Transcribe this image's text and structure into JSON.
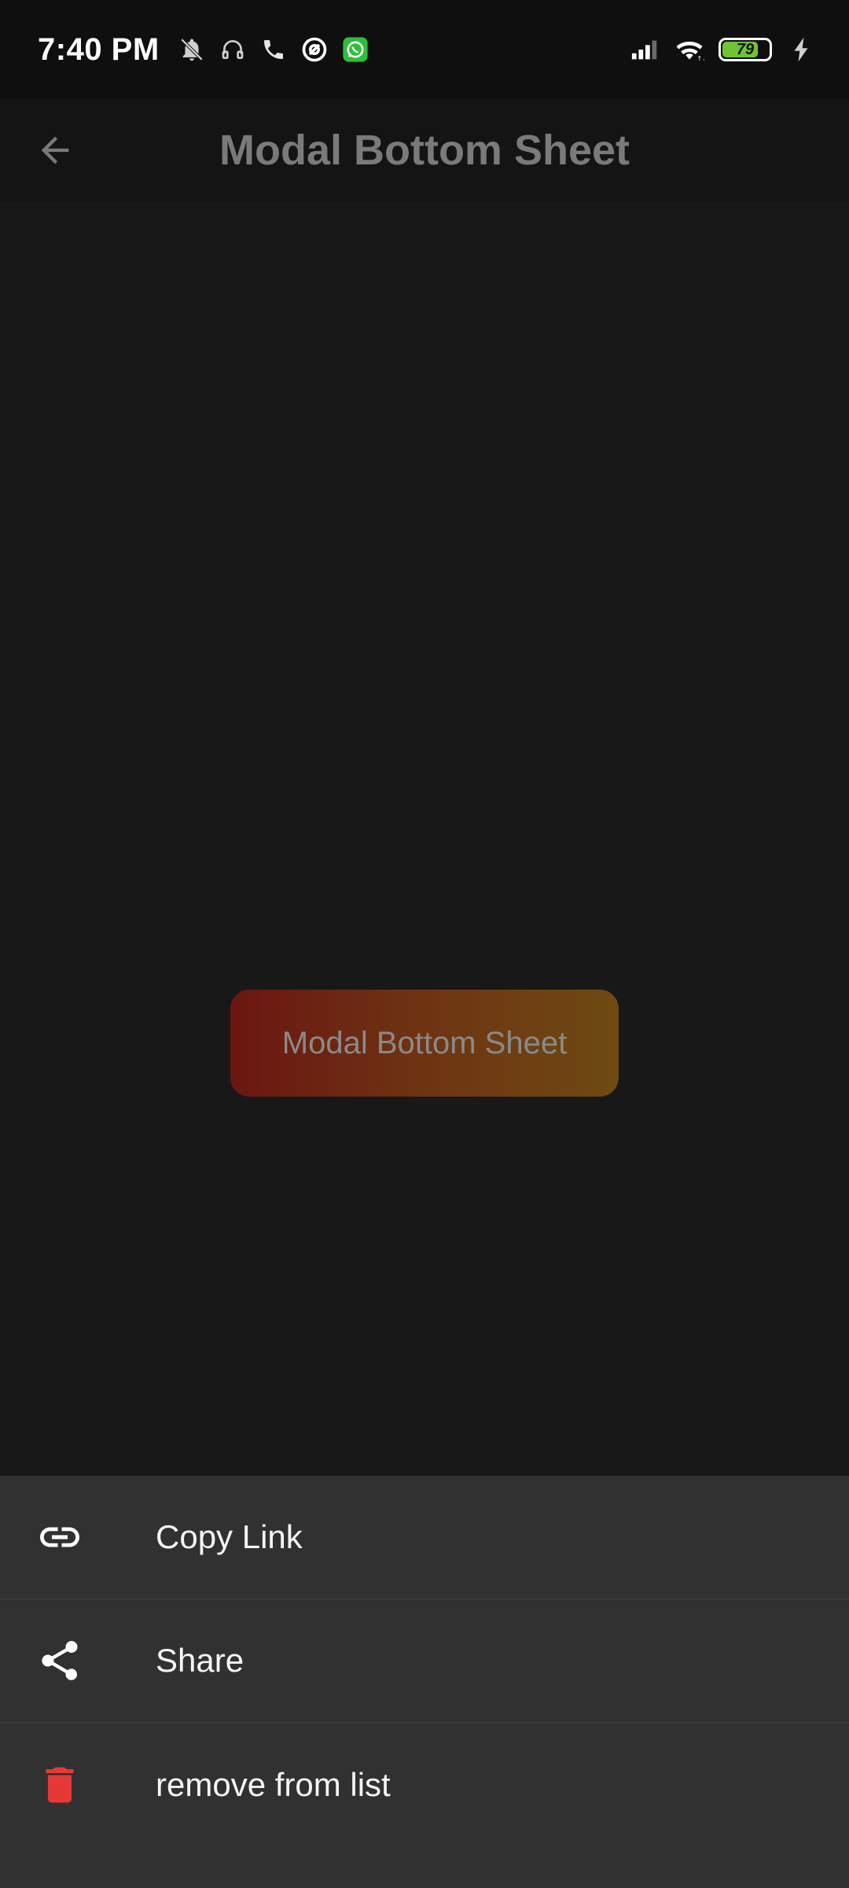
{
  "status_bar": {
    "time": "7:40 PM",
    "battery_level": "79",
    "battery_fill_percent": 79,
    "icons_left": [
      "bell-off-icon",
      "headset-icon",
      "phone-icon",
      "at-sign-icon",
      "whatsapp-icon"
    ],
    "icons_right": [
      "signal-icon",
      "wifi-icon",
      "battery-icon",
      "charging-icon"
    ],
    "battery_color": "#6ec531"
  },
  "app_bar": {
    "title": "Modal Bottom Sheet",
    "back_icon": "arrow-back-icon"
  },
  "main": {
    "button_label": "Modal Bottom Sheet",
    "button_gradient": [
      "#6b1611",
      "#6e4a12"
    ]
  },
  "bottom_sheet": {
    "items": [
      {
        "label": "Copy Link",
        "icon": "link-icon"
      },
      {
        "label": "Share",
        "icon": "share-icon"
      },
      {
        "label": "remove from list",
        "icon": "trash-icon",
        "icon_color": "#e53935"
      }
    ]
  }
}
